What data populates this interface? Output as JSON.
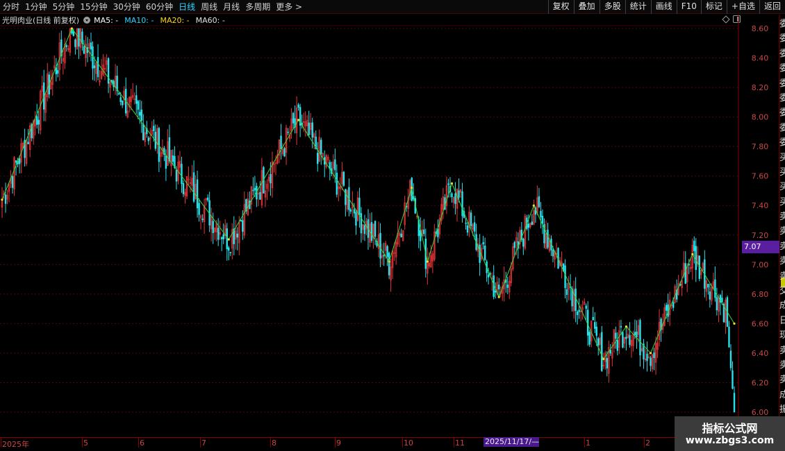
{
  "toolbar": {
    "periods": [
      {
        "label": "分时",
        "active": false
      },
      {
        "label": "1分钟",
        "active": false
      },
      {
        "label": "5分钟",
        "active": false
      },
      {
        "label": "15分钟",
        "active": false
      },
      {
        "label": "30分钟",
        "active": false
      },
      {
        "label": "60分钟",
        "active": false
      },
      {
        "label": "日线",
        "active": true
      },
      {
        "label": "周线",
        "active": false
      },
      {
        "label": "月线",
        "active": false
      },
      {
        "label": "多周期",
        "active": false
      },
      {
        "label": "更多 >",
        "active": false
      }
    ],
    "tools": [
      "复权",
      "叠加",
      "多股",
      "统计",
      "画线",
      "F10",
      "标记",
      "+自选",
      "返回"
    ]
  },
  "header": {
    "title": "光明肉业(日线 前复权)",
    "ma": [
      {
        "label": "MA5: -",
        "color": "#ffffff"
      },
      {
        "label": "MA10: -",
        "color": "#2ad6ff"
      },
      {
        "label": "MA20: -",
        "color": "#ffd800"
      },
      {
        "label": "MA60: -",
        "color": "#e0e0e0"
      }
    ]
  },
  "price_box": "7.07",
  "cursor_date": "2025/11/17/—",
  "side_panel_chars": [
    "委",
    "委",
    "委",
    "委",
    "委",
    "委",
    "委",
    "委",
    "委",
    "买",
    "买",
    "买",
    "买",
    "卖",
    "卖",
    "卖",
    "卖",
    "卖",
    "交",
    "成",
    "日",
    "现",
    "卖",
    "卖",
    "卖",
    "成",
    "振",
    "外"
  ],
  "watermark": {
    "title": "指标公式网",
    "url": "www.zbgs3.com"
  },
  "colors": {
    "up": "#e8363a",
    "down": "#23e6f0",
    "zigzag": "#39d839",
    "grid": "#5a0a0a",
    "axis_text": "#c84848"
  },
  "chart_data": {
    "type": "candlestick",
    "ylim": [
      6.0,
      8.6
    ],
    "y_ticks": [
      "8.60",
      "8.40",
      "8.20",
      "8.00",
      "7.80",
      "7.60",
      "7.40",
      "7.20",
      "7.00",
      "6.80",
      "6.60",
      "6.40",
      "6.20",
      "6.00"
    ],
    "x_labels": [
      "2025年",
      "5",
      "6",
      "7",
      "8",
      "9",
      "10",
      "11",
      "1",
      "2"
    ],
    "zigzag_points": [
      {
        "i": 0,
        "price": 7.44
      },
      {
        "i": 40,
        "price": 8.6
      },
      {
        "i": 130,
        "price": 7.17
      },
      {
        "i": 170,
        "price": 7.98
      },
      {
        "i": 222,
        "price": 7.02
      },
      {
        "i": 235,
        "price": 7.52
      },
      {
        "i": 244,
        "price": 7.02
      },
      {
        "i": 258,
        "price": 7.55
      },
      {
        "i": 285,
        "price": 6.78
      },
      {
        "i": 305,
        "price": 7.4
      },
      {
        "i": 345,
        "price": 6.36
      },
      {
        "i": 358,
        "price": 6.58
      },
      {
        "i": 372,
        "price": 6.4
      },
      {
        "i": 396,
        "price": 7.07
      },
      {
        "i": 420,
        "price": 6.6
      }
    ]
  }
}
